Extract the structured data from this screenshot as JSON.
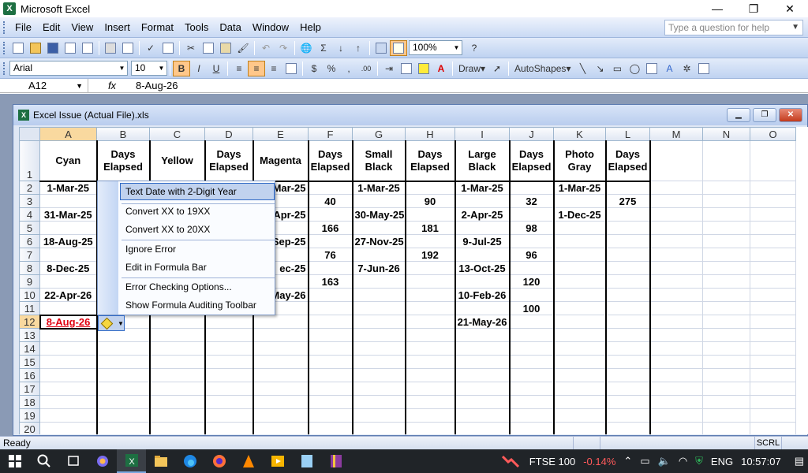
{
  "app": {
    "title": "Microsoft Excel",
    "minimize_glyph": "—",
    "maximize_glyph": "❐",
    "close_glyph": "✕"
  },
  "menu": {
    "items": [
      "File",
      "Edit",
      "View",
      "Insert",
      "Format",
      "Tools",
      "Data",
      "Window",
      "Help"
    ],
    "help_placeholder": "Type a question for help"
  },
  "toolbar": {
    "zoom": "100%",
    "font": "Arial",
    "font_size": "10",
    "bold_label": "B",
    "italic_label": "I",
    "underline_label": "U",
    "draw_label": "Draw",
    "autoshapes_label": "AutoShapes",
    "percent_label": "%",
    "comma_label": ",",
    "decimal_label": ".00",
    "sum_glyph": "Σ"
  },
  "formula_bar": {
    "name_box": "A12",
    "fx": "fx",
    "content": "8-Aug-26"
  },
  "workbook": {
    "title": "Excel Issue (Actual File).xls"
  },
  "sheet": {
    "columns": [
      "A",
      "B",
      "C",
      "D",
      "E",
      "F",
      "G",
      "H",
      "I",
      "J",
      "K",
      "L",
      "M",
      "N",
      "O"
    ],
    "headers": [
      "Cyan",
      "Days Elapsed",
      "Yellow",
      "Days Elapsed",
      "Magenta",
      "Days Elapsed",
      "Small Black",
      "Days Elapsed",
      "Large Black",
      "Days Elapsed",
      "Photo Gray",
      "Days Elapsed",
      "",
      "",
      ""
    ],
    "rows": [
      [
        "1-Mar-25",
        "",
        "",
        "",
        "-Mar-25",
        "",
        "1-Mar-25",
        "",
        "1-Mar-25",
        "",
        "1-Mar-25",
        "",
        "",
        "",
        ""
      ],
      [
        "",
        "",
        "",
        "",
        "",
        "40",
        "",
        "90",
        "",
        "32",
        "",
        "275",
        "",
        "",
        ""
      ],
      [
        "31-Mar-25",
        "",
        "",
        "",
        "Apr-25",
        "",
        "30-May-25",
        "",
        "2-Apr-25",
        "",
        "1-Dec-25",
        "",
        "",
        "",
        ""
      ],
      [
        "",
        "",
        "",
        "",
        "",
        "166",
        "",
        "181",
        "",
        "98",
        "",
        "",
        "",
        "",
        ""
      ],
      [
        "18-Aug-25",
        "",
        "",
        "",
        "Sep-25",
        "",
        "27-Nov-25",
        "",
        "9-Jul-25",
        "",
        "",
        "",
        "",
        "",
        ""
      ],
      [
        "",
        "",
        "",
        "",
        "",
        "76",
        "",
        "192",
        "",
        "96",
        "",
        "",
        "",
        "",
        ""
      ],
      [
        "8-Dec-25",
        "",
        "",
        "",
        "ec-25",
        "",
        "7-Jun-26",
        "",
        "13-Oct-25",
        "",
        "",
        "",
        "",
        "",
        ""
      ],
      [
        "",
        "",
        "",
        "",
        "",
        "163",
        "",
        "",
        "",
        "120",
        "",
        "",
        "",
        "",
        ""
      ],
      [
        "22-Apr-26",
        "",
        "",
        "",
        "May-26",
        "",
        "",
        "",
        "10-Feb-26",
        "",
        "",
        "",
        "",
        "",
        ""
      ],
      [
        "",
        "",
        "",
        "",
        "",
        "",
        "",
        "",
        "",
        "100",
        "",
        "",
        "",
        "",
        ""
      ],
      [
        "8-Aug-26",
        "",
        "",
        "",
        "",
        "",
        "",
        "",
        "21-May-26",
        "",
        "",
        "",
        "",
        "",
        ""
      ],
      [
        "",
        "",
        "",
        "",
        "",
        "",
        "",
        "",
        "",
        "",
        "",
        "",
        "",
        "",
        ""
      ],
      [
        "",
        "",
        "",
        "",
        "",
        "",
        "",
        "",
        "",
        "",
        "",
        "",
        "",
        "",
        ""
      ],
      [
        "",
        "",
        "",
        "",
        "",
        "",
        "",
        "",
        "",
        "",
        "",
        "",
        "",
        "",
        ""
      ],
      [
        "",
        "",
        "",
        "",
        "",
        "",
        "",
        "",
        "",
        "",
        "",
        "",
        "",
        "",
        ""
      ],
      [
        "",
        "",
        "",
        "",
        "",
        "",
        "",
        "",
        "",
        "",
        "",
        "",
        "",
        "",
        ""
      ],
      [
        "",
        "",
        "",
        "",
        "",
        "",
        "",
        "",
        "",
        "",
        "",
        "",
        "",
        "",
        ""
      ],
      [
        "",
        "",
        "",
        "",
        "",
        "",
        "",
        "",
        "",
        "",
        "",
        "",
        "",
        "",
        ""
      ],
      [
        "",
        "",
        "",
        "",
        "",
        "",
        "",
        "",
        "",
        "",
        "",
        "",
        "",
        "",
        ""
      ]
    ],
    "row_numbers": [
      "1",
      "2",
      "3",
      "4",
      "5",
      "6",
      "7",
      "8",
      "9",
      "10",
      "11",
      "12",
      "13",
      "14",
      "15",
      "16",
      "17",
      "18",
      "19",
      "20"
    ]
  },
  "context_menu": {
    "items": [
      "Text Date with 2-Digit Year",
      "Convert XX to 19XX",
      "Convert XX to 20XX",
      "Ignore Error",
      "Edit in Formula Bar",
      "Error Checking Options...",
      "Show Formula Auditing Toolbar"
    ],
    "highlighted": "Text Date with 2-Digit Year"
  },
  "status": {
    "text": "Ready",
    "scrl": "SCRL"
  },
  "taskbar": {
    "ticker": "FTSE 100",
    "change": "-0.14%",
    "lang": "ENG",
    "time": "10:57:07"
  },
  "colors": {
    "accent": "#316ac5",
    "error_text": "#e0000f",
    "ftse_negative": "#ff5a5a"
  }
}
